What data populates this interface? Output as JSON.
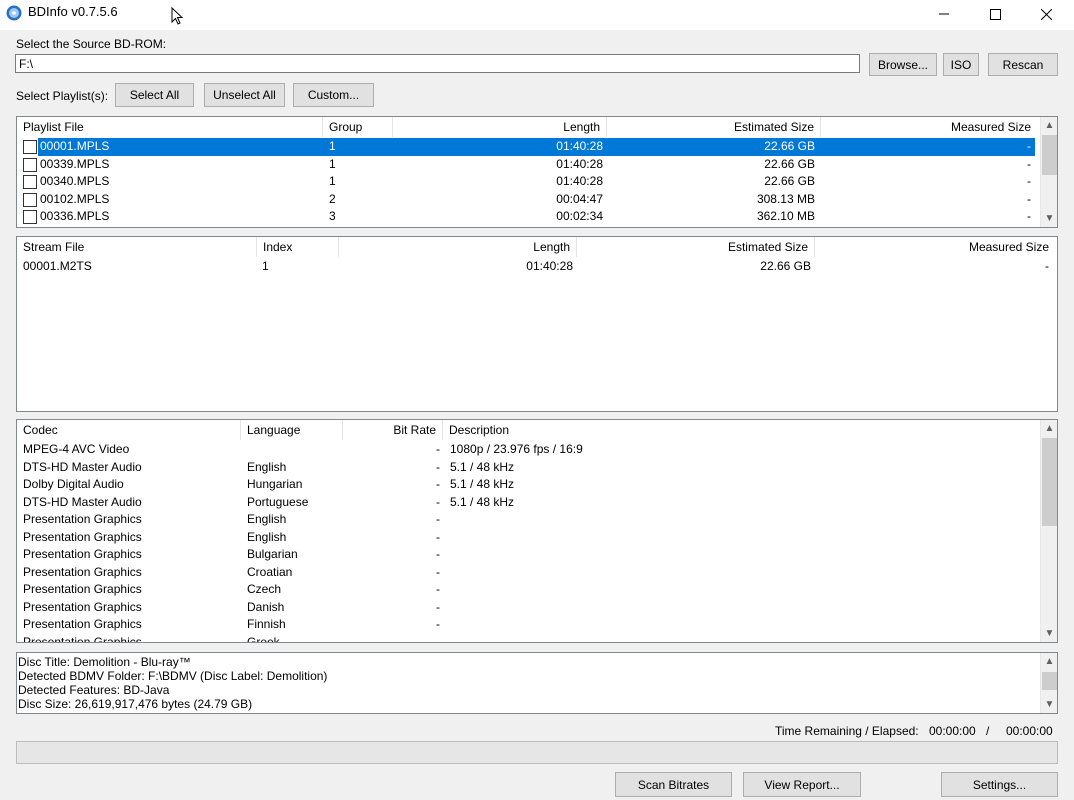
{
  "window": {
    "title": "BDInfo v0.7.5.6"
  },
  "source": {
    "label": "Select the Source BD-ROM:",
    "path": "F:\\"
  },
  "buttons": {
    "browse": "Browse...",
    "iso": "ISO",
    "rescan": "Rescan",
    "select_all": "Select All",
    "unselect_all": "Unselect All",
    "custom": "Custom...",
    "scan_bitrates": "Scan Bitrates",
    "view_report": "View Report...",
    "settings": "Settings..."
  },
  "playlist_label": "Select Playlist(s):",
  "playlists": {
    "headers": [
      "Playlist File",
      "Group",
      "Length",
      "Estimated Size",
      "Measured Size"
    ],
    "rows": [
      {
        "file": "00001.MPLS",
        "group": "1",
        "length": "01:40:28",
        "est": "22.66 GB",
        "measured": "-",
        "selected": true
      },
      {
        "file": "00339.MPLS",
        "group": "1",
        "length": "01:40:28",
        "est": "22.66 GB",
        "measured": "-"
      },
      {
        "file": "00340.MPLS",
        "group": "1",
        "length": "01:40:28",
        "est": "22.66 GB",
        "measured": "-"
      },
      {
        "file": "00102.MPLS",
        "group": "2",
        "length": "00:04:47",
        "est": "308.13 MB",
        "measured": "-"
      },
      {
        "file": "00336.MPLS",
        "group": "3",
        "length": "00:02:34",
        "est": "362.10 MB",
        "measured": "-"
      }
    ]
  },
  "streams": {
    "headers": [
      "Stream File",
      "Index",
      "Length",
      "Estimated Size",
      "Measured Size"
    ],
    "rows": [
      {
        "file": "00001.M2TS",
        "index": "1",
        "length": "01:40:28",
        "est": "22.66 GB",
        "measured": "-"
      }
    ]
  },
  "codecs": {
    "headers": [
      "Codec",
      "Language",
      "Bit Rate",
      "Description"
    ],
    "rows": [
      {
        "codec": "MPEG-4 AVC Video",
        "lang": "",
        "rate": "-",
        "desc": "1080p / 23.976 fps / 16:9"
      },
      {
        "codec": "DTS-HD Master Audio",
        "lang": "English",
        "rate": "-",
        "desc": "5.1 / 48 kHz"
      },
      {
        "codec": "Dolby Digital Audio",
        "lang": "Hungarian",
        "rate": "-",
        "desc": "5.1 / 48 kHz"
      },
      {
        "codec": "DTS-HD Master Audio",
        "lang": "Portuguese",
        "rate": "-",
        "desc": "5.1 / 48 kHz"
      },
      {
        "codec": "Presentation Graphics",
        "lang": "English",
        "rate": "-",
        "desc": ""
      },
      {
        "codec": "Presentation Graphics",
        "lang": "English",
        "rate": "-",
        "desc": ""
      },
      {
        "codec": "Presentation Graphics",
        "lang": "Bulgarian",
        "rate": "-",
        "desc": ""
      },
      {
        "codec": "Presentation Graphics",
        "lang": "Croatian",
        "rate": "-",
        "desc": ""
      },
      {
        "codec": "Presentation Graphics",
        "lang": "Czech",
        "rate": "-",
        "desc": ""
      },
      {
        "codec": "Presentation Graphics",
        "lang": "Danish",
        "rate": "-",
        "desc": ""
      },
      {
        "codec": "Presentation Graphics",
        "lang": "Finnish",
        "rate": "-",
        "desc": ""
      },
      {
        "codec": "Presentation Graphics",
        "lang": "Greek",
        "rate": "",
        "desc": ""
      }
    ]
  },
  "disc_info": {
    "lines": [
      "Disc Title: Demolition - Blu-ray™",
      "Detected BDMV Folder: F:\\BDMV (Disc Label: Demolition)",
      "Detected Features: BD-Java",
      "Disc Size: 26,619,917,476 bytes (24.79 GB)"
    ]
  },
  "status": {
    "time_label": "Time Remaining / Elapsed:",
    "remaining": "00:00:00",
    "separator": "/",
    "elapsed": "00:00:00",
    "progress": 0
  },
  "colors": {
    "selection": "#0078d7"
  }
}
